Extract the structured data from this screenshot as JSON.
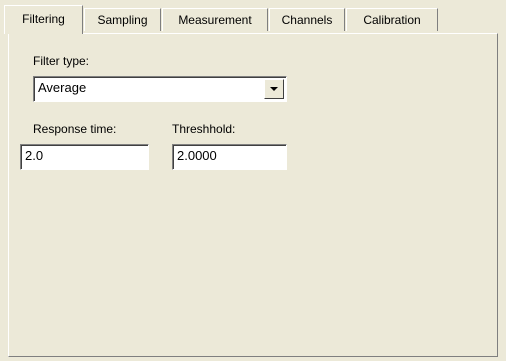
{
  "tabs": [
    {
      "label": "Filtering",
      "active": true
    },
    {
      "label": "Sampling",
      "active": false
    },
    {
      "label": "Measurement",
      "active": false
    },
    {
      "label": "Channels",
      "active": false
    },
    {
      "label": "Calibration",
      "active": false
    }
  ],
  "filtering": {
    "filter_type_label": "Filter type:",
    "filter_type_value": "Average",
    "response_time_label": "Response time:",
    "response_time_value": "2.0",
    "threshold_label": "Threshhold:",
    "threshold_value": "2.0000"
  }
}
